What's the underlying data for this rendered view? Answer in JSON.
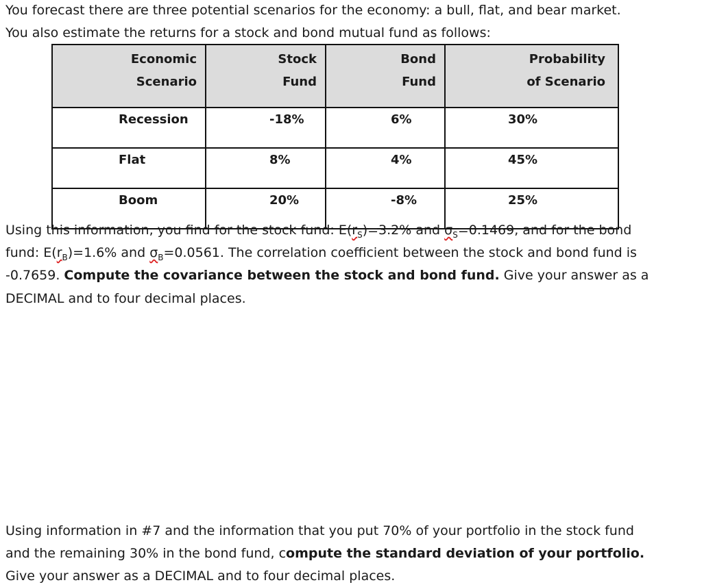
{
  "intro": {
    "line1": "You forecast there are three potential scenarios for the economy: a bull, flat, and bear market.",
    "line2": "You also estimate the returns for a stock and bond mutual fund as follows:"
  },
  "table": {
    "headers": [
      {
        "l1": "Economic",
        "l2": "Scenario"
      },
      {
        "l1": "Stock",
        "l2": "Fund"
      },
      {
        "l1": "Bond",
        "l2": "Fund"
      },
      {
        "l1": "Probability",
        "l2": "of Scenario"
      }
    ],
    "rows": [
      {
        "scenario": "Recession",
        "stock": "-18%",
        "bond": "6%",
        "prob": "30%"
      },
      {
        "scenario": "Flat",
        "stock": "8%",
        "bond": "4%",
        "prob": "45%"
      },
      {
        "scenario": "Boom",
        "stock": "20%",
        "bond": "-8%",
        "prob": "25%"
      }
    ]
  },
  "q7": {
    "l1a": "Using this information, you find for the stock fund: E(",
    "r": "r",
    "subS": "S",
    "l1b": ")=3.2% and ",
    "sigma": "σ",
    "l1c": "=0.1469, and for the bond",
    "l2a": "fund: E(",
    "subB": "B",
    "l2b": ")=1.6% and ",
    "l2c": "=0.0561. The correlation coefficient between the stock and bond fund is",
    "l3a": "-0.7659. ",
    "l3bold": "Compute the covariance between the stock and bond fund.",
    "l3b": " Give your answer as a",
    "l4": "DECIMAL and to four decimal places."
  },
  "q8": {
    "l1": "Using information in #7 and the information that you put 70% of your portfolio in the stock fund",
    "l2a": "and the remaining 30% in the bond fund, c",
    "l2bold": "ompute the standard deviation of your portfolio.",
    "l3": "Give your answer as a DECIMAL and to four decimal places."
  }
}
